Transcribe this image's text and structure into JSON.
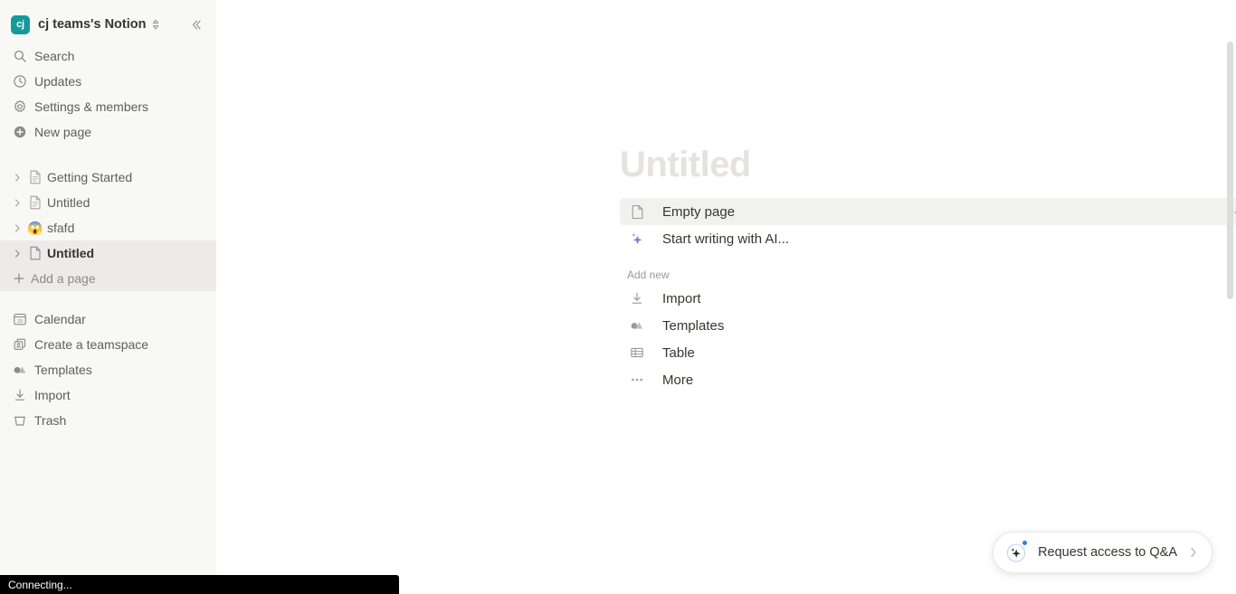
{
  "sidebar": {
    "workspace": {
      "avatar_text": "cj",
      "avatar_color": "#139a9c",
      "name": "cj teams's Notion",
      "switcher_icon": "chevron-up-down-icon",
      "collapse_icon": "double-chevron-left-icon"
    },
    "nav": [
      {
        "label": "Search",
        "icon": "search-icon"
      },
      {
        "label": "Updates",
        "icon": "clock-icon"
      },
      {
        "label": "Settings & members",
        "icon": "gear-icon"
      },
      {
        "label": "New page",
        "icon": "plus-circle-icon"
      }
    ],
    "tree": [
      {
        "label": "Getting Started",
        "icon": "page-icon",
        "selected": false
      },
      {
        "label": "Untitled",
        "icon": "page-icon",
        "selected": false
      },
      {
        "label": "sfafd",
        "icon": "emoji-screaming-face",
        "emoji": "😱",
        "selected": false
      },
      {
        "label": "Untitled",
        "icon": "blank-page-icon",
        "selected": true
      }
    ],
    "add_page": {
      "label": "Add a page",
      "icon": "plus-icon"
    },
    "bottom": [
      {
        "label": "Calendar",
        "icon": "calendar-icon",
        "day": "29"
      },
      {
        "label": "Create a teamspace",
        "icon": "teamspace-icon"
      },
      {
        "label": "Templates",
        "icon": "templates-icon"
      },
      {
        "label": "Import",
        "icon": "import-icon"
      },
      {
        "label": "Trash",
        "icon": "trash-icon"
      }
    ]
  },
  "main": {
    "title_placeholder": "Untitled",
    "primary_options": [
      {
        "label": "Empty page",
        "icon": "page-icon",
        "active": true,
        "shortcut_icon": "enter-key-icon"
      },
      {
        "label": "Start writing with AI...",
        "icon": "ai-sparkle-icon",
        "active": false
      }
    ],
    "add_new_label": "Add new",
    "add_new_options": [
      {
        "label": "Import",
        "icon": "import-icon"
      },
      {
        "label": "Templates",
        "icon": "templates-icon"
      },
      {
        "label": "Table",
        "icon": "table-icon"
      },
      {
        "label": "More",
        "icon": "ellipsis-icon"
      }
    ]
  },
  "qa_widget": {
    "label": "Request access to Q&A",
    "icon": "ai-sparkle-circle-icon",
    "chevron_icon": "chevron-right-icon",
    "badge_color": "#2e7cf6"
  },
  "status_bar": {
    "text": "Connecting..."
  }
}
